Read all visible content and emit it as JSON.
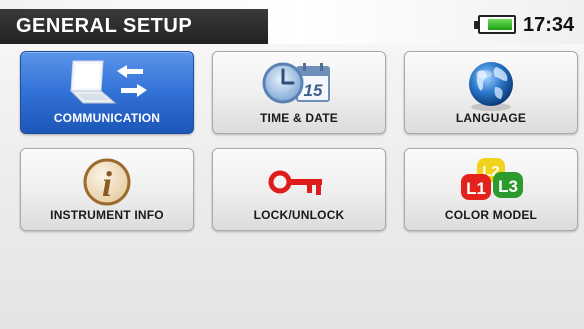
{
  "header": {
    "title": "GENERAL SETUP",
    "time": "17:34",
    "battery_level": 0.8,
    "battery_icon": "battery-icon"
  },
  "colors": {
    "title_bar": "#2c2c2c",
    "selected_tile": "#3271d6",
    "battery_green": "#3cc22a",
    "lock_key": "#e01b1b"
  },
  "tiles": [
    {
      "label": "COMMUNICATION",
      "icon": "laptop-transfer-icon",
      "selected": true
    },
    {
      "label": "TIME & DATE",
      "icon": "clock-calendar-icon",
      "calendar_day": "15",
      "selected": false
    },
    {
      "label": "LANGUAGE",
      "icon": "globe-icon",
      "selected": false
    },
    {
      "label": "INSTRUMENT INFO",
      "icon": "info-icon",
      "info_glyph": "i",
      "selected": false
    },
    {
      "label": "LOCK/UNLOCK",
      "icon": "key-icon",
      "selected": false
    },
    {
      "label": "COLOR MODEL",
      "icon": "phase-colors-icon",
      "phases": [
        "L1",
        "L2",
        "L3"
      ],
      "phase_colors": [
        "#e3231b",
        "#f2d21a",
        "#2d9a2d"
      ],
      "selected": false
    }
  ]
}
